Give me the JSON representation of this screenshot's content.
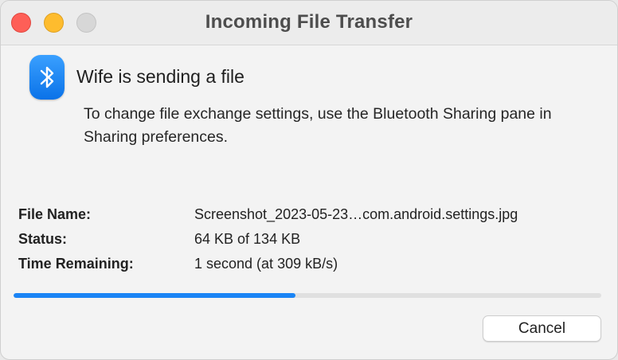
{
  "window": {
    "title": "Incoming File Transfer"
  },
  "icons": {
    "app": "bluetooth-icon"
  },
  "message": {
    "headline": "Wife is sending a file",
    "info": "To change file exchange settings, use the Bluetooth Sharing pane in Sharing preferences."
  },
  "details": {
    "file_name_label": "File Name:",
    "file_name_value": "Screenshot_2023-05-23…com.android.settings.jpg",
    "status_label": "Status:",
    "status_value": "64 KB of 134 KB",
    "time_label": "Time Remaining:",
    "time_value": "1 second (at 309 kB/s)"
  },
  "progress": {
    "fraction": 0.48
  },
  "buttons": {
    "cancel_label": "Cancel"
  },
  "colors": {
    "accent": "#1a84f5",
    "close": "#fe5f57",
    "minimize": "#febc2e",
    "zoom_disabled": "#d7d7d7"
  }
}
